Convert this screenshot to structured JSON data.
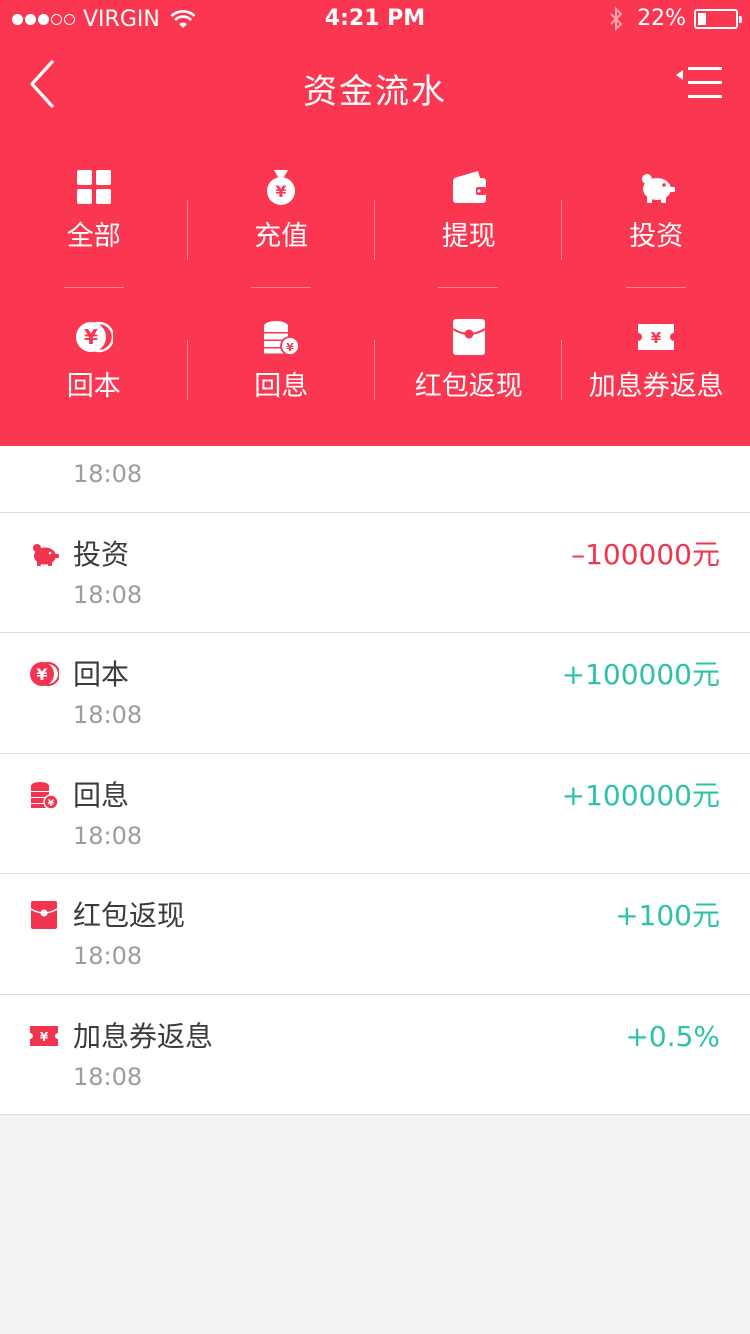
{
  "status_bar": {
    "carrier": "VIRGIN",
    "time": "4:21 PM",
    "battery": "22%"
  },
  "nav": {
    "title": "资金流水"
  },
  "filters": [
    {
      "label": "全部",
      "icon": "grid-icon"
    },
    {
      "label": "充值",
      "icon": "money-bag-icon"
    },
    {
      "label": "提现",
      "icon": "wallet-icon"
    },
    {
      "label": "投资",
      "icon": "piggy-bank-icon"
    },
    {
      "label": "回本",
      "icon": "coin-return-icon"
    },
    {
      "label": "回息",
      "icon": "coin-stack-icon"
    },
    {
      "label": "红包返现",
      "icon": "red-envelope-icon"
    },
    {
      "label": "加息券返息",
      "icon": "coupon-icon"
    }
  ],
  "transactions": [
    {
      "type": "",
      "time": "18:08",
      "amount": "",
      "icon": ""
    },
    {
      "type": "投资",
      "time": "18:08",
      "amount": "–100000元",
      "icon": "piggy-bank-icon"
    },
    {
      "type": "回本",
      "time": "18:08",
      "amount": "+100000元",
      "icon": "coin-return-icon"
    },
    {
      "type": "回息",
      "time": "18:08",
      "amount": "+100000元",
      "icon": "coin-stack-icon"
    },
    {
      "type": "红包返现",
      "time": "18:08",
      "amount": "+100元",
      "icon": "red-envelope-icon"
    },
    {
      "type": "加息券返息",
      "time": "18:08",
      "amount": "+0.5%",
      "icon": "coupon-icon"
    }
  ],
  "colors": {
    "brand": "#fb3650",
    "negative": "#f2344e",
    "positive": "#2dc3a8",
    "background": "#f2f2f2"
  }
}
